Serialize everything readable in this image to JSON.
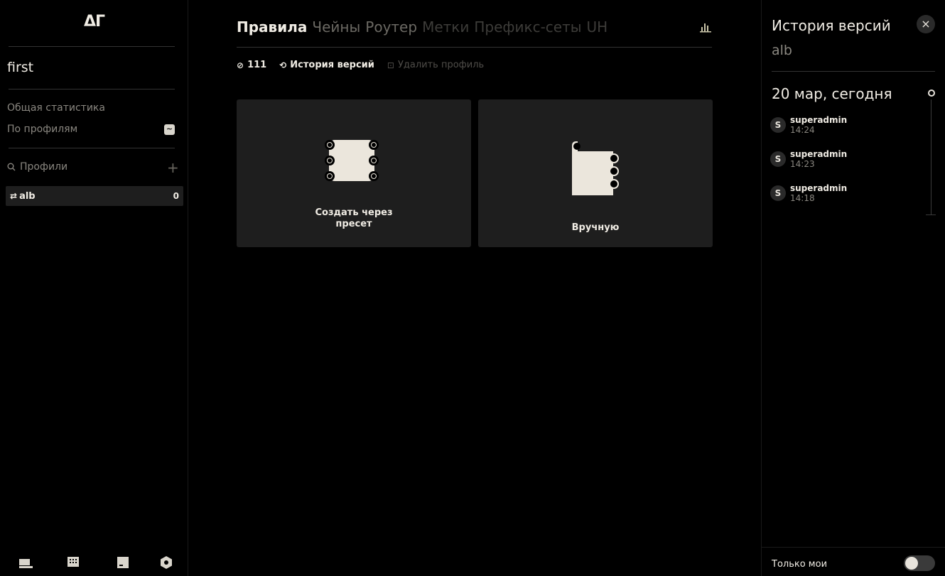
{
  "sidebar": {
    "logo": "ΔГ",
    "project_title": "first",
    "nav": {
      "general_stats": "Общая статистика",
      "by_profiles": "По профилям",
      "by_profiles_badge": "~"
    },
    "search_label": "Профили",
    "add_symbol": "+",
    "profiles": [
      {
        "sync_symbol": "⇄",
        "name": "alb",
        "count": "0"
      }
    ]
  },
  "main": {
    "tabs": [
      {
        "label": "Правила",
        "state": "active"
      },
      {
        "label": "Чейны",
        "state": "mid"
      },
      {
        "label": "Роутер",
        "state": "mid"
      },
      {
        "label": "Метки",
        "state": "dim"
      },
      {
        "label": "Префикс-сеты",
        "state": "dim"
      },
      {
        "label": "UH",
        "state": "dim"
      }
    ],
    "toolbar": {
      "count_symbol": "⊘",
      "count": "111",
      "history_symbol": "⟲",
      "history": "История версий",
      "delete_symbol": "⊡",
      "delete": "Удалить профиль"
    },
    "cards": {
      "preset_label": "Создать через пресет",
      "manual_label": "Вручную"
    }
  },
  "panel": {
    "title": "История версий",
    "subtitle": "alb",
    "close_symbol": "×",
    "date_heading": "20 мар, сегодня",
    "versions": [
      {
        "avatar": "S",
        "user": "superadmin",
        "time": "14:24"
      },
      {
        "avatar": "S",
        "user": "superadmin",
        "time": "14:23"
      },
      {
        "avatar": "S",
        "user": "superadmin",
        "time": "14:18"
      }
    ],
    "only_mine_label": "Только мои",
    "only_mine_enabled": false
  },
  "colors": {
    "background": "#000000",
    "card": "#1e1e1e",
    "text_primary": "#f0ece4",
    "text_secondary": "#8a8780",
    "icon_fill": "#e8e4dc"
  }
}
